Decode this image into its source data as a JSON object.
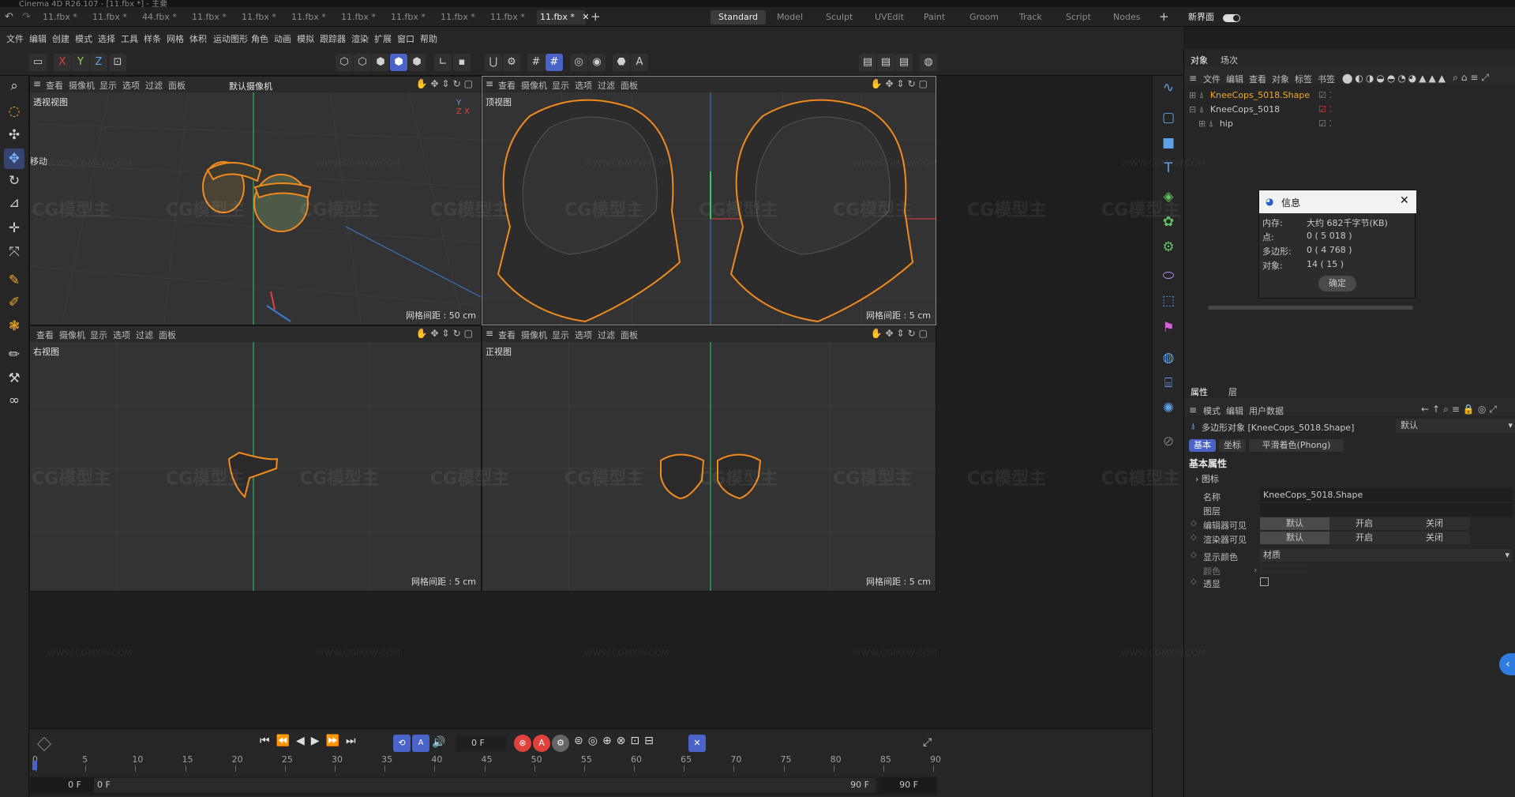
{
  "window": {
    "title": "Cinema 4D R26.107 - [11.fbx *] - 主要"
  },
  "tabs": [
    {
      "label": "11.fbx *"
    },
    {
      "label": "11.fbx *"
    },
    {
      "label": "44.fbx *"
    },
    {
      "label": "11.fbx *"
    },
    {
      "label": "11.fbx *"
    },
    {
      "label": "11.fbx *"
    },
    {
      "label": "11.fbx *"
    },
    {
      "label": "11.fbx *"
    },
    {
      "label": "11.fbx *"
    },
    {
      "label": "11.fbx *"
    },
    {
      "label": "11.fbx *"
    }
  ],
  "layouts": [
    "Standard",
    "Model",
    "Sculpt",
    "UVEdit",
    "Paint",
    "Groom",
    "Track",
    "Script",
    "Nodes"
  ],
  "new_interface": "新界面",
  "menu": [
    "文件",
    "编辑",
    "创建",
    "模式",
    "选择",
    "工具",
    "样条",
    "网格",
    "体积",
    "运动图形",
    "角色",
    "动画",
    "模拟",
    "跟踪器",
    "渲染",
    "扩展",
    "窗口",
    "帮助"
  ],
  "viewport_menu": [
    "查看",
    "摄像机",
    "显示",
    "选项",
    "过滤",
    "面板"
  ],
  "viewports": {
    "persp": {
      "name": "透视视图",
      "camera": "默认摄像机",
      "grid": "网格间距 : 50 cm",
      "tool": "移动"
    },
    "top": {
      "name": "顶视图",
      "grid": "网格间距 : 5 cm"
    },
    "right": {
      "name": "右视图",
      "grid": "网格间距 : 5 cm"
    },
    "front": {
      "name": "正视图",
      "grid": "网格间距 : 5 cm"
    }
  },
  "object_panel": {
    "tabs": [
      "对象",
      "场次"
    ],
    "menu": [
      "文件",
      "编辑",
      "查看",
      "对象",
      "标签",
      "书签"
    ],
    "items": [
      {
        "label": "KneeCops_5018.Shape",
        "color": "#f0a928"
      },
      {
        "label": "KneeCops_5018",
        "color": "#c8c8c8"
      },
      {
        "label": "hip",
        "color": "#c8c8c8"
      }
    ]
  },
  "info_dialog": {
    "title": "信息",
    "rows": [
      {
        "label": "内存:",
        "value": "大约 682千字节(KB)"
      },
      {
        "label": "点:",
        "value": "0 ( 5 018 )"
      },
      {
        "label": "多边形:",
        "value": "0 ( 4 768 )"
      },
      {
        "label": "对象:",
        "value": "14 ( 15 )"
      }
    ],
    "ok": "确定"
  },
  "attr_panel": {
    "tabs": [
      "属性",
      "层"
    ],
    "menu": [
      "模式",
      "编辑",
      "用户数据"
    ],
    "object": "多边形对象 [KneeCops_5018.Shape]",
    "preset": "默认",
    "subtabs": [
      "基本",
      "坐标",
      "平滑着色(Phong)"
    ],
    "section": "基本属性",
    "icon_group": "图标",
    "name_label": "名称",
    "name_value": "KneeCops_5018.Shape",
    "layer_label": "图层",
    "editor_label": "编辑器可见",
    "render_label": "渲染器可见",
    "vis_options": [
      "默认",
      "开启",
      "关闭"
    ],
    "display_color_label": "显示颜色",
    "display_color_value": "材质",
    "color_label": "颜色",
    "xray_label": "透显"
  },
  "timeline": {
    "ticks": [
      "0",
      "5",
      "10",
      "15",
      "20",
      "25",
      "30",
      "35",
      "40",
      "45",
      "50",
      "55",
      "60",
      "65",
      "70",
      "75",
      "80",
      "85",
      "90"
    ],
    "current_frame": "0 F",
    "start": "0 F",
    "start2": "0 F",
    "end": "90 F",
    "end2": "90 F"
  },
  "watermark": {
    "text": "CG模型主",
    "url": "WWW.CGMXW.COM"
  },
  "colors": {
    "accent": "#4a63c8",
    "selection": "#f0a928",
    "axis_y": "#2ecc71",
    "axis_x": "#e0413c",
    "axis_z": "#3a7bd5"
  }
}
